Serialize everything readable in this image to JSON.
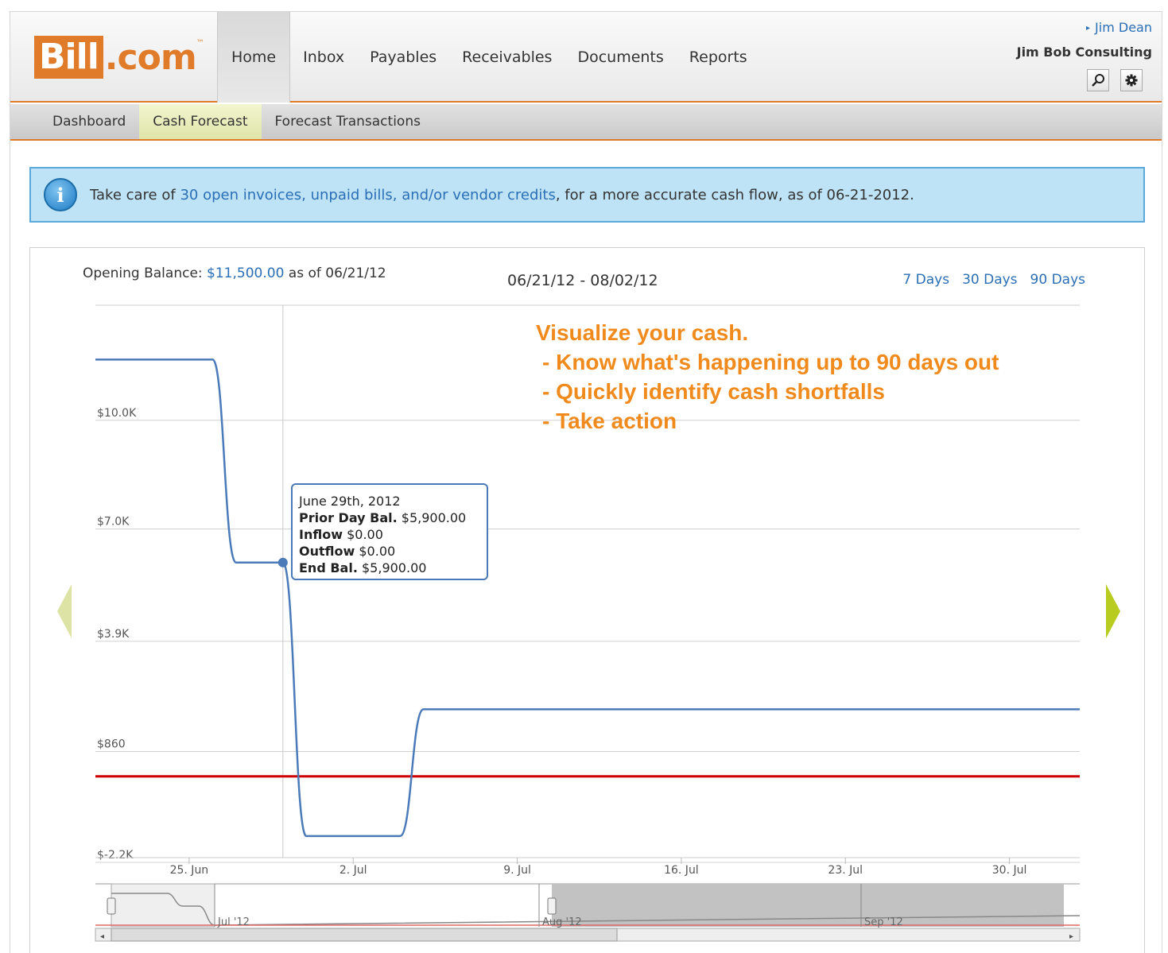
{
  "header": {
    "logo_main": "Bill",
    "logo_rest": ".com",
    "logo_tm": "™",
    "nav": [
      "Home",
      "Inbox",
      "Payables",
      "Receivables",
      "Documents",
      "Reports"
    ],
    "active_nav": "Home",
    "user_name": "Jim Dean",
    "company": "Jim Bob Consulting"
  },
  "subnav": {
    "items": [
      "Dashboard",
      "Cash Forecast",
      "Forecast Transactions"
    ],
    "active": "Cash Forecast"
  },
  "info_bar": {
    "prefix": "Take care of ",
    "link": "30 open invoices, unpaid bills, and/or vendor credits",
    "suffix": ", for a more accurate cash flow, as of 06-21-2012."
  },
  "forecast": {
    "opening_label": "Opening Balance:",
    "opening_value": "$11,500.00",
    "opening_suffix": "as of 06/21/12",
    "date_range": "06/21/12 - 08/02/12",
    "range_options": [
      "7 Days",
      "30 Days",
      "90 Days"
    ]
  },
  "tooltip": {
    "date": "June 29th, 2012",
    "prior_label": "Prior Day Bal.",
    "prior_value": "$5,900.00",
    "inflow_label": "Inflow",
    "inflow_value": "$0.00",
    "outflow_label": "Outflow",
    "outflow_value": "$0.00",
    "end_label": "End Bal.",
    "end_value": "$5,900.00"
  },
  "annotation": {
    "title": "Visualize your cash.",
    "bullets": [
      "- Know what's happening up to 90 days out",
      "- Quickly identify cash shortfalls",
      "- Take action"
    ]
  },
  "colors": {
    "accent": "#e07b2a",
    "line": "#4a7ab8",
    "threshold": "#cc0000",
    "link": "#2a6fb6"
  },
  "chart_data": {
    "type": "line",
    "title": "",
    "xlabel": "",
    "ylabel": "",
    "y_ticks": [
      "$-2.2K",
      "$860",
      "$3.9K",
      "$7.0K",
      "$10.0K"
    ],
    "y_tick_values": [
      -2200,
      860,
      3900,
      7000,
      10000
    ],
    "ylim": [
      -2200,
      13000
    ],
    "x_ticks": [
      "25. Jun",
      "2. Jul",
      "9. Jul",
      "16. Jul",
      "23. Jul",
      "30. Jul"
    ],
    "x_tick_days": [
      4,
      11,
      18,
      25,
      32,
      39
    ],
    "xlim_days": [
      0,
      42
    ],
    "x_origin": "2012-06-21",
    "series": [
      {
        "name": "",
        "points_day_value": [
          [
            0,
            11500
          ],
          [
            5,
            11500
          ],
          [
            6,
            5900
          ],
          [
            8,
            5900
          ],
          [
            9,
            -1650
          ],
          [
            13,
            -1650
          ],
          [
            14,
            1850
          ],
          [
            42,
            1850
          ]
        ]
      }
    ],
    "threshold_value": 0,
    "highlight_point": [
      8,
      5900
    ],
    "navigator_labels": [
      "Jul '12",
      "Aug '12",
      "Sep '12"
    ],
    "grid": true
  }
}
